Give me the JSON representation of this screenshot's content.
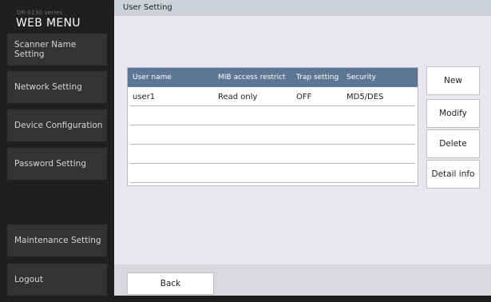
{
  "sidebar": {
    "model_label": "DR-S130 series",
    "menu_title": "WEB MENU",
    "items": [
      {
        "label": "Scanner Name Setting"
      },
      {
        "label": "Network Setting"
      },
      {
        "label": "Device Configuration"
      },
      {
        "label": "Password Setting"
      },
      {
        "label": "Maintenance Setting"
      },
      {
        "label": "Logout"
      }
    ]
  },
  "header": {
    "title": "User Setting"
  },
  "table": {
    "columns": [
      "User name",
      "MIB access restrict",
      "Trap setting",
      "Security"
    ],
    "rows": [
      [
        "user1",
        "Read only",
        "OFF",
        "MD5/DES"
      ],
      [
        "",
        "",
        "",
        ""
      ],
      [
        "",
        "",
        "",
        ""
      ],
      [
        "",
        "",
        "",
        ""
      ],
      [
        "",
        "",
        "",
        ""
      ]
    ]
  },
  "actions": {
    "new_label": "New",
    "modify_label": "Modify",
    "delete_label": "Delete",
    "detail_label": "Detail info"
  },
  "footer": {
    "back_label": "Back"
  },
  "colors": {
    "sidebar_bg": "#1f1f1f",
    "nav_item_bg": "#333333",
    "table_header_bg": "#5c7694",
    "content_bg": "#e8e8ee"
  }
}
